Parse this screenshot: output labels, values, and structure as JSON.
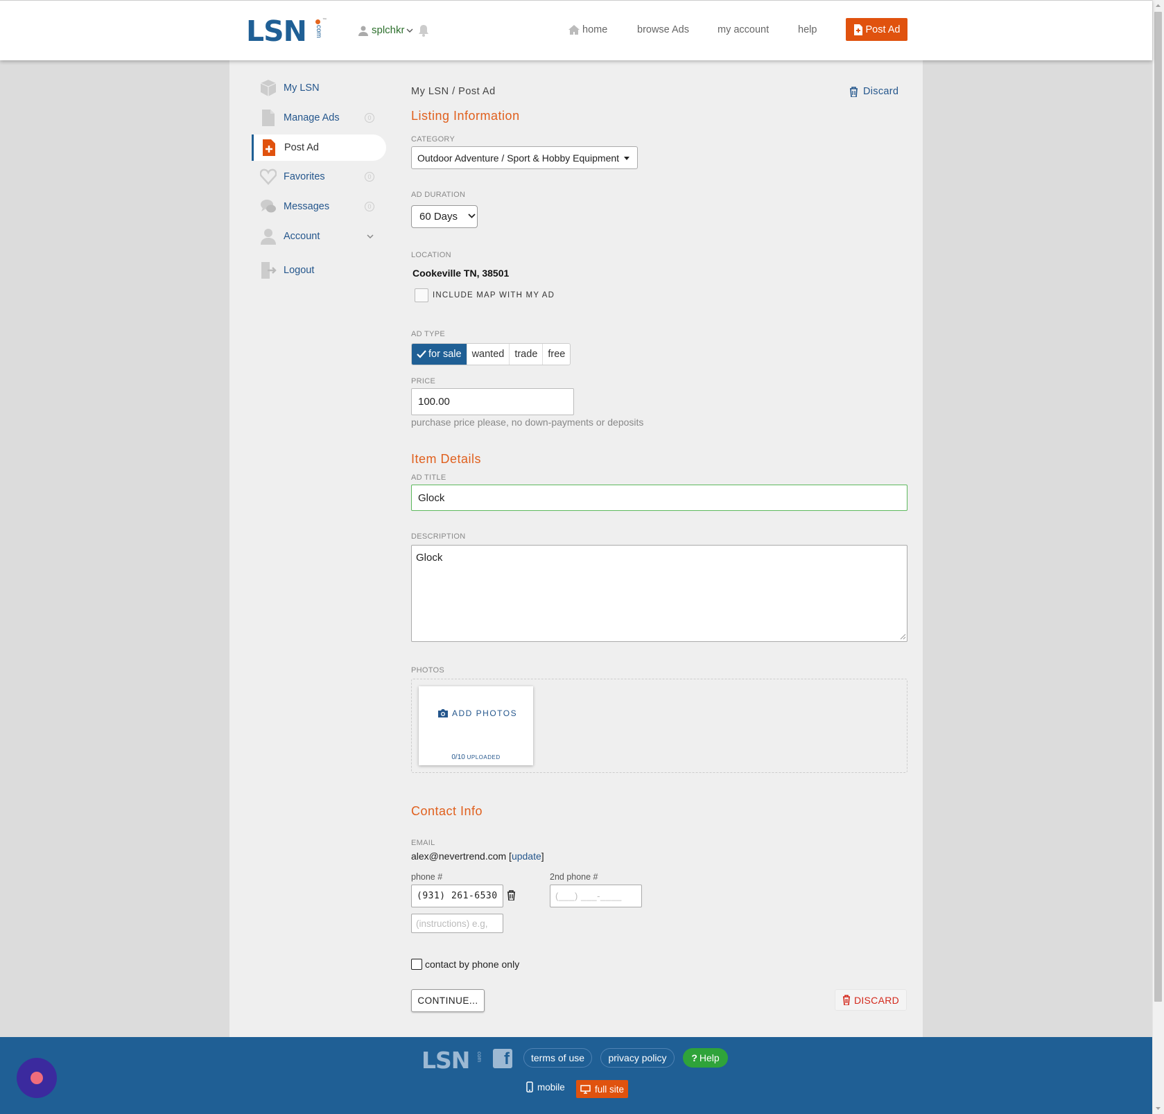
{
  "header": {
    "logo": "LSN",
    "logo_suffix": "com",
    "logo_tm": "™",
    "username": "splchkr",
    "nav": [
      "home",
      "browse Ads",
      "my account",
      "help"
    ],
    "post_ad_label": "Post Ad"
  },
  "sidebar": {
    "items": [
      {
        "label": "My LSN",
        "count": ""
      },
      {
        "label": "Manage Ads",
        "count": "0"
      },
      {
        "label": "Post Ad",
        "count": ""
      },
      {
        "label": "Favorites",
        "count": "0"
      },
      {
        "label": "Messages",
        "count": "0"
      },
      {
        "label": "Account",
        "count": ""
      },
      {
        "label": "Logout",
        "count": ""
      }
    ]
  },
  "main": {
    "breadcrumb": "My LSN / Post Ad",
    "discard_top": "Discard",
    "listing_title": "Listing Information",
    "category_label": "CATEGORY",
    "category_value": "Outdoor Adventure / Sport & Hobby Equipment",
    "duration_label": "AD DURATION",
    "duration_value": "60 Days",
    "location_label": "LOCATION",
    "location_value": "Cookeville TN, 38501",
    "include_map_label": "INCLUDE MAP WITH MY AD",
    "ad_type_label": "AD TYPE",
    "ad_types": [
      "for sale",
      "wanted",
      "trade",
      "free"
    ],
    "price_label": "PRICE",
    "price_value": "100.00",
    "price_hint": "purchase price please, no down-payments or deposits",
    "item_details_title": "Item Details",
    "ad_title_label": "AD TITLE",
    "ad_title_value": "Glock",
    "description_label": "DESCRIPTION",
    "description_value": "Glock",
    "photos_label": "PHOTOS",
    "add_photos_label": "ADD PHOTOS",
    "uploaded_count": "0/10",
    "uploaded_label": "UPLOADED",
    "contact_title": "Contact Info",
    "email_label": "EMAIL",
    "email_value": "alex@nevertrend.com",
    "update_link": "update",
    "phone_label": "phone #",
    "phone_value": "(931) 261-6530",
    "phone2_label": "2nd phone #",
    "phone2_placeholder": "(___) ___-____",
    "instructions_placeholder": "(instructions) e.g,",
    "phone_only_label": "contact by phone only",
    "continue_label": "CONTINUE...",
    "discard_bottom": "DISCARD"
  },
  "footer": {
    "logo": "LSN",
    "logo_suffix": "com",
    "facebook": "f",
    "terms": "terms of use",
    "privacy": "privacy policy",
    "help": "Help",
    "help_mark": "?",
    "mobile": "mobile",
    "full_site": "full site"
  },
  "colors": {
    "brand_blue": "#1f5f95",
    "accent_orange": "#e0520e",
    "section_orange": "#e0601e",
    "success_green": "#5cb85c",
    "discard_red": "#d3281b"
  }
}
